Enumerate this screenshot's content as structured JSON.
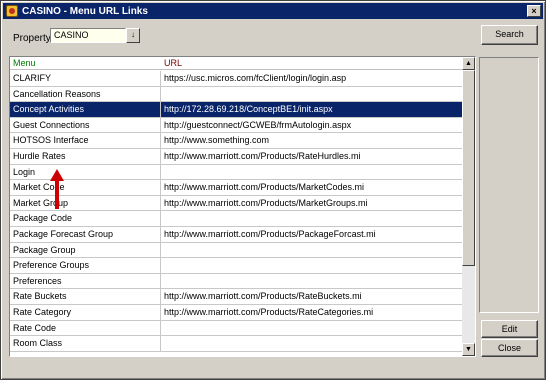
{
  "window": {
    "title": "CASINO - Menu URL Links",
    "close_glyph": "×"
  },
  "property": {
    "label": "Property",
    "value": "CASINO",
    "dropdown_glyph": "↓"
  },
  "buttons": {
    "search": "Search",
    "edit": "Edit",
    "close": "Close"
  },
  "grid": {
    "columns": [
      "Menu",
      "URL"
    ],
    "rows": [
      {
        "menu": "CLARIFY",
        "url": "https://usc.micros.com/fcClient/login/login.asp",
        "selected": false
      },
      {
        "menu": "Cancellation Reasons",
        "url": "",
        "selected": false
      },
      {
        "menu": "Concept Activities",
        "url": "http://172.28.69.218/ConceptBE1/init.aspx",
        "selected": true
      },
      {
        "menu": "Guest Connections",
        "url": "http://guestconnect/GCWEB/frmAutologin.aspx",
        "selected": false
      },
      {
        "menu": "HOTSOS Interface",
        "url": "http://www.something.com",
        "selected": false
      },
      {
        "menu": "Hurdle Rates",
        "url": "http://www.marriott.com/Products/RateHurdles.mi",
        "selected": false
      },
      {
        "menu": "Login",
        "url": "",
        "selected": false
      },
      {
        "menu": "Market Code",
        "url": "http://www.marriott.com/Products/MarketCodes.mi",
        "selected": false
      },
      {
        "menu": "Market Group",
        "url": "http://www.marriott.com/Products/MarketGroups.mi",
        "selected": false
      },
      {
        "menu": "Package Code",
        "url": "",
        "selected": false
      },
      {
        "menu": "Package Forecast Group",
        "url": "http://www.marriott.com/Products/PackageForcast.mi",
        "selected": false
      },
      {
        "menu": "Package Group",
        "url": "",
        "selected": false
      },
      {
        "menu": "Preference Groups",
        "url": "",
        "selected": false
      },
      {
        "menu": "Preferences",
        "url": "",
        "selected": false
      },
      {
        "menu": "Rate Buckets",
        "url": "http://www.marriott.com/Products/RateBuckets.mi",
        "selected": false
      },
      {
        "menu": "Rate Category",
        "url": "http://www.marriott.com/Products/RateCategories.mi",
        "selected": false
      },
      {
        "menu": "Rate Code",
        "url": "",
        "selected": false
      },
      {
        "menu": "Room Class",
        "url": "",
        "selected": false
      }
    ],
    "scroll_up_glyph": "▲",
    "scroll_down_glyph": "▼"
  },
  "colors": {
    "selection": "#0a246a",
    "annotation_arrow": "#cc0000",
    "menu_header": "#008000",
    "url_header": "#800000"
  }
}
